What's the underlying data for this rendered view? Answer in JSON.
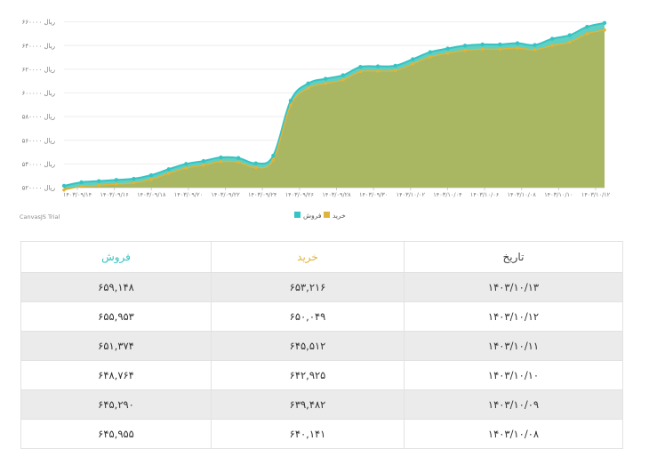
{
  "colors": {
    "sell_line": "#36c3c3",
    "sell_fill": "#5fd0c2",
    "buy_line": "#e0b43a",
    "buy_fill": "#a9b763",
    "header_buy": "#e0b43a",
    "header_sell": "#36c3c3",
    "header_date": "#444444"
  },
  "chart_data": {
    "type": "area",
    "y_unit_label": "ریال",
    "ylim": [
      520000,
      665000
    ],
    "y_ticks": [
      520000,
      540000,
      560000,
      580000,
      600000,
      620000,
      640000,
      660000
    ],
    "y_tick_labels": [
      "۵۲۰۰۰۰",
      "۵۴۰۰۰۰",
      "۵۶۰۰۰۰",
      "۵۸۰۰۰۰",
      "۶۰۰۰۰۰",
      "۶۲۰۰۰۰",
      "۶۴۰۰۰۰",
      "۶۶۰۰۰۰"
    ],
    "x_tick_labels": [
      "۱۴۰۳/۰۹/۱۴",
      "۱۴۰۳/۰۹/۱۶",
      "۱۴۰۳/۰۹/۱۸",
      "۱۴۰۳/۰۹/۲۰",
      "۱۴۰۳/۰۹/۲۲",
      "۱۴۰۳/۰۹/۲۴",
      "۱۴۰۳/۰۹/۲۶",
      "۱۴۰۳/۰۹/۲۸",
      "۱۴۰۳/۰۹/۳۰",
      "۱۴۰۳/۱۰/۰۲",
      "۱۴۰۳/۱۰/۰۴",
      "۱۴۰۳/۱۰/۰۶",
      "۱۴۰۳/۱۰/۰۸",
      "۱۴۰۳/۱۰/۱۰",
      "۱۴۰۳/۱۰/۱۲"
    ],
    "series": [
      {
        "name": "فروش",
        "values": [
          521500,
          524500,
          525500,
          526500,
          527500,
          530500,
          535500,
          540000,
          542500,
          545500,
          545000,
          540500,
          547000,
          593500,
          608000,
          612000,
          615000,
          622000,
          622500,
          623000,
          628500,
          634500,
          637500,
          640000,
          641000,
          641000,
          642000,
          640500,
          645800,
          648800,
          655900,
          659100
        ]
      },
      {
        "name": "خرید",
        "values": [
          518000,
          521000,
          522000,
          523000,
          524000,
          527000,
          532000,
          536500,
          539000,
          542000,
          541500,
          537000,
          543500,
          589500,
          604000,
          608000,
          611000,
          618000,
          618500,
          619000,
          624500,
          630500,
          633500,
          636000,
          637000,
          637000,
          638000,
          636500,
          640100,
          642900,
          650000,
          653200
        ]
      }
    ]
  },
  "legend": {
    "buy": "خرید",
    "sell": "فروش"
  },
  "watermark": "CanvasJS Trial",
  "table": {
    "headers": {
      "date": "تاریخ",
      "buy": "خرید",
      "sell": "فروش"
    },
    "rows": [
      {
        "date": "۱۴۰۳/۱۰/۱۳",
        "buy": "۶۵۳,۲۱۶",
        "sell": "۶۵۹,۱۴۸"
      },
      {
        "date": "۱۴۰۳/۱۰/۱۲",
        "buy": "۶۵۰,۰۴۹",
        "sell": "۶۵۵,۹۵۳"
      },
      {
        "date": "۱۴۰۳/۱۰/۱۱",
        "buy": "۶۴۵,۵۱۲",
        "sell": "۶۵۱,۳۷۴"
      },
      {
        "date": "۱۴۰۳/۱۰/۱۰",
        "buy": "۶۴۲,۹۲۵",
        "sell": "۶۴۸,۷۶۴"
      },
      {
        "date": "۱۴۰۳/۱۰/۰۹",
        "buy": "۶۳۹,۴۸۲",
        "sell": "۶۴۵,۲۹۰"
      },
      {
        "date": "۱۴۰۳/۱۰/۰۸",
        "buy": "۶۴۰,۱۴۱",
        "sell": "۶۴۵,۹۵۵"
      }
    ]
  }
}
